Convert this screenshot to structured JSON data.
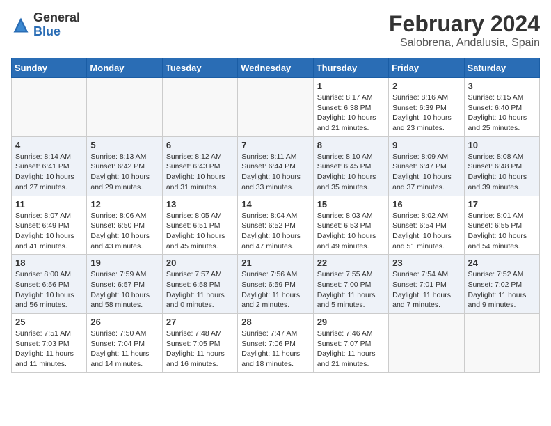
{
  "header": {
    "logo_general": "General",
    "logo_blue": "Blue",
    "month_title": "February 2024",
    "location": "Salobrena, Andalusia, Spain"
  },
  "weekdays": [
    "Sunday",
    "Monday",
    "Tuesday",
    "Wednesday",
    "Thursday",
    "Friday",
    "Saturday"
  ],
  "weeks": [
    [
      {
        "day": "",
        "info": ""
      },
      {
        "day": "",
        "info": ""
      },
      {
        "day": "",
        "info": ""
      },
      {
        "day": "",
        "info": ""
      },
      {
        "day": "1",
        "info": "Sunrise: 8:17 AM\nSunset: 6:38 PM\nDaylight: 10 hours\nand 21 minutes."
      },
      {
        "day": "2",
        "info": "Sunrise: 8:16 AM\nSunset: 6:39 PM\nDaylight: 10 hours\nand 23 minutes."
      },
      {
        "day": "3",
        "info": "Sunrise: 8:15 AM\nSunset: 6:40 PM\nDaylight: 10 hours\nand 25 minutes."
      }
    ],
    [
      {
        "day": "4",
        "info": "Sunrise: 8:14 AM\nSunset: 6:41 PM\nDaylight: 10 hours\nand 27 minutes."
      },
      {
        "day": "5",
        "info": "Sunrise: 8:13 AM\nSunset: 6:42 PM\nDaylight: 10 hours\nand 29 minutes."
      },
      {
        "day": "6",
        "info": "Sunrise: 8:12 AM\nSunset: 6:43 PM\nDaylight: 10 hours\nand 31 minutes."
      },
      {
        "day": "7",
        "info": "Sunrise: 8:11 AM\nSunset: 6:44 PM\nDaylight: 10 hours\nand 33 minutes."
      },
      {
        "day": "8",
        "info": "Sunrise: 8:10 AM\nSunset: 6:45 PM\nDaylight: 10 hours\nand 35 minutes."
      },
      {
        "day": "9",
        "info": "Sunrise: 8:09 AM\nSunset: 6:47 PM\nDaylight: 10 hours\nand 37 minutes."
      },
      {
        "day": "10",
        "info": "Sunrise: 8:08 AM\nSunset: 6:48 PM\nDaylight: 10 hours\nand 39 minutes."
      }
    ],
    [
      {
        "day": "11",
        "info": "Sunrise: 8:07 AM\nSunset: 6:49 PM\nDaylight: 10 hours\nand 41 minutes."
      },
      {
        "day": "12",
        "info": "Sunrise: 8:06 AM\nSunset: 6:50 PM\nDaylight: 10 hours\nand 43 minutes."
      },
      {
        "day": "13",
        "info": "Sunrise: 8:05 AM\nSunset: 6:51 PM\nDaylight: 10 hours\nand 45 minutes."
      },
      {
        "day": "14",
        "info": "Sunrise: 8:04 AM\nSunset: 6:52 PM\nDaylight: 10 hours\nand 47 minutes."
      },
      {
        "day": "15",
        "info": "Sunrise: 8:03 AM\nSunset: 6:53 PM\nDaylight: 10 hours\nand 49 minutes."
      },
      {
        "day": "16",
        "info": "Sunrise: 8:02 AM\nSunset: 6:54 PM\nDaylight: 10 hours\nand 51 minutes."
      },
      {
        "day": "17",
        "info": "Sunrise: 8:01 AM\nSunset: 6:55 PM\nDaylight: 10 hours\nand 54 minutes."
      }
    ],
    [
      {
        "day": "18",
        "info": "Sunrise: 8:00 AM\nSunset: 6:56 PM\nDaylight: 10 hours\nand 56 minutes."
      },
      {
        "day": "19",
        "info": "Sunrise: 7:59 AM\nSunset: 6:57 PM\nDaylight: 10 hours\nand 58 minutes."
      },
      {
        "day": "20",
        "info": "Sunrise: 7:57 AM\nSunset: 6:58 PM\nDaylight: 11 hours\nand 0 minutes."
      },
      {
        "day": "21",
        "info": "Sunrise: 7:56 AM\nSunset: 6:59 PM\nDaylight: 11 hours\nand 2 minutes."
      },
      {
        "day": "22",
        "info": "Sunrise: 7:55 AM\nSunset: 7:00 PM\nDaylight: 11 hours\nand 5 minutes."
      },
      {
        "day": "23",
        "info": "Sunrise: 7:54 AM\nSunset: 7:01 PM\nDaylight: 11 hours\nand 7 minutes."
      },
      {
        "day": "24",
        "info": "Sunrise: 7:52 AM\nSunset: 7:02 PM\nDaylight: 11 hours\nand 9 minutes."
      }
    ],
    [
      {
        "day": "25",
        "info": "Sunrise: 7:51 AM\nSunset: 7:03 PM\nDaylight: 11 hours\nand 11 minutes."
      },
      {
        "day": "26",
        "info": "Sunrise: 7:50 AM\nSunset: 7:04 PM\nDaylight: 11 hours\nand 14 minutes."
      },
      {
        "day": "27",
        "info": "Sunrise: 7:48 AM\nSunset: 7:05 PM\nDaylight: 11 hours\nand 16 minutes."
      },
      {
        "day": "28",
        "info": "Sunrise: 7:47 AM\nSunset: 7:06 PM\nDaylight: 11 hours\nand 18 minutes."
      },
      {
        "day": "29",
        "info": "Sunrise: 7:46 AM\nSunset: 7:07 PM\nDaylight: 11 hours\nand 21 minutes."
      },
      {
        "day": "",
        "info": ""
      },
      {
        "day": "",
        "info": ""
      }
    ]
  ]
}
